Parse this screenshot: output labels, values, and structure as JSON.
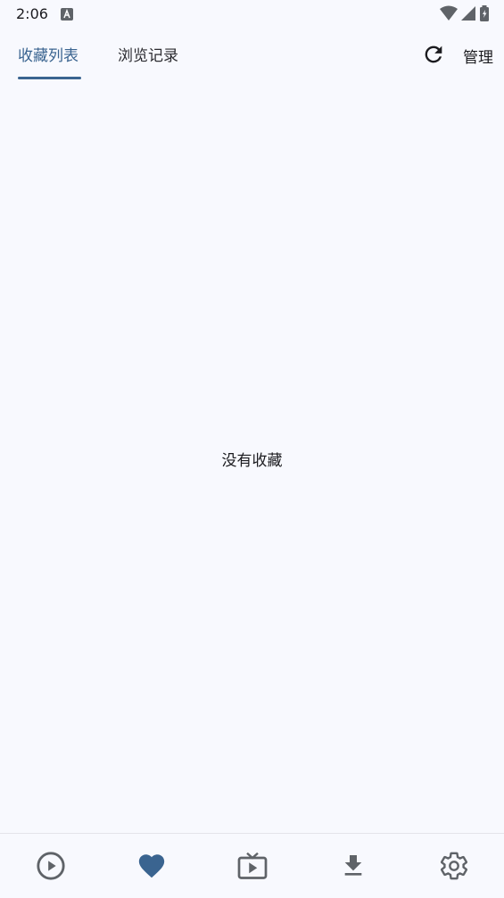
{
  "status_bar": {
    "time": "2:06"
  },
  "tabs": [
    {
      "label": "收藏列表",
      "selected": true
    },
    {
      "label": "浏览记录",
      "selected": false
    }
  ],
  "toolbar": {
    "manage_label": "管理"
  },
  "empty_state": {
    "message": "没有收藏"
  },
  "bottom_nav": {
    "items": [
      {
        "icon": "play-circle-icon",
        "selected": false
      },
      {
        "icon": "heart-icon",
        "selected": true
      },
      {
        "icon": "tv-play-icon",
        "selected": false
      },
      {
        "icon": "download-icon",
        "selected": false
      },
      {
        "icon": "gear-icon",
        "selected": false
      }
    ]
  },
  "colors": {
    "accent": "#3a6490",
    "background": "#f8f9fe",
    "icon_inactive": "#5f6368",
    "text": "#1b1b1f"
  }
}
